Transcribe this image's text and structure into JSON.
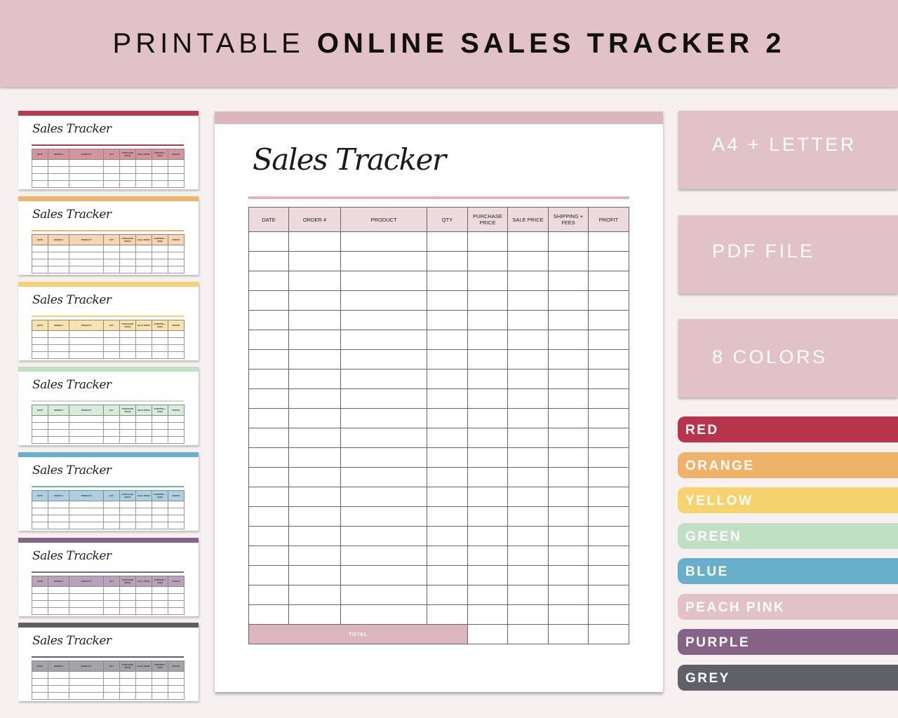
{
  "banner": {
    "title_light": "PRINTABLE",
    "title_bold": "ONLINE SALES TRACKER 2"
  },
  "sheet": {
    "title": "Sales Tracker",
    "columns": [
      "DATE",
      "ORDER #",
      "PRODUCT",
      "QTY",
      "PURCHASE PRICE",
      "SALE PRICE",
      "SHIPPING + FEES",
      "PROFIT"
    ],
    "empty_rows": 20,
    "total_label": "TOTAL",
    "accent": "#dcb6bf",
    "header_fill": "#ecdadd"
  },
  "mini_cards": [
    {
      "name": "red",
      "title": "Sales Tracker",
      "accent": "#b83a51",
      "header_fill": "#d3949d"
    },
    {
      "name": "orange",
      "title": "Sales Tracker",
      "accent": "#efb36a",
      "header_fill": "#f7d5b1"
    },
    {
      "name": "yellow",
      "title": "Sales Tracker",
      "accent": "#f4d271",
      "header_fill": "#f8e3ad"
    },
    {
      "name": "green",
      "title": "Sales Tracker",
      "accent": "#bfe0c4",
      "header_fill": "#d8ecdb"
    },
    {
      "name": "blue",
      "title": "Sales Tracker",
      "accent": "#6aafcc",
      "header_fill": "#abd0e1"
    },
    {
      "name": "purple",
      "title": "Sales Tracker",
      "accent": "#856286",
      "header_fill": "#b9a3ba"
    },
    {
      "name": "grey",
      "title": "Sales Tracker",
      "accent": "#5e5f66",
      "header_fill": "#a3a4aa"
    }
  ],
  "features": [
    "A4 + LETTER",
    "PDF FILE",
    "8 COLORS"
  ],
  "colors": [
    {
      "label": "RED",
      "hex": "#b8344b"
    },
    {
      "label": "ORANGE",
      "hex": "#efb26a"
    },
    {
      "label": "YELLOW",
      "hex": "#f5d36f"
    },
    {
      "label": "GREEN",
      "hex": "#c0e0c3"
    },
    {
      "label": "BLUE",
      "hex": "#67afcb"
    },
    {
      "label": "PEACH PINK",
      "hex": "#e2c2c9"
    },
    {
      "label": "PURPLE",
      "hex": "#856286"
    },
    {
      "label": "GREY",
      "hex": "#5f6068"
    }
  ]
}
